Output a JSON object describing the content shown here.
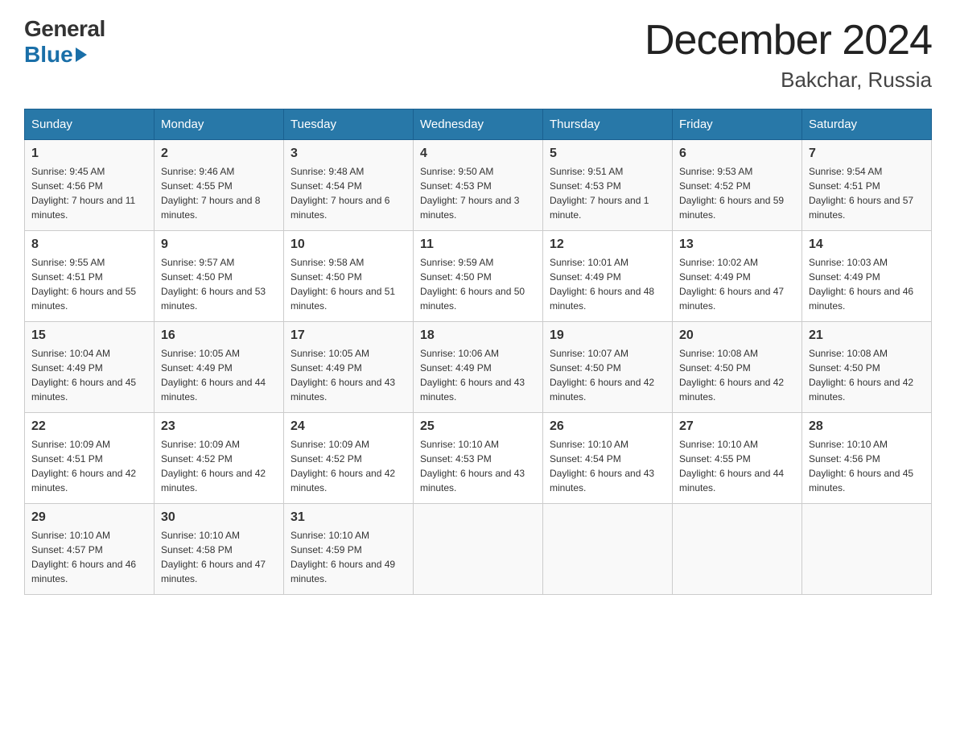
{
  "header": {
    "logo_general": "General",
    "logo_blue": "Blue",
    "month_title": "December 2024",
    "location": "Bakchar, Russia"
  },
  "days_of_week": [
    "Sunday",
    "Monday",
    "Tuesday",
    "Wednesday",
    "Thursday",
    "Friday",
    "Saturday"
  ],
  "weeks": [
    [
      {
        "day": "1",
        "sunrise": "9:45 AM",
        "sunset": "4:56 PM",
        "daylight": "7 hours and 11 minutes."
      },
      {
        "day": "2",
        "sunrise": "9:46 AM",
        "sunset": "4:55 PM",
        "daylight": "7 hours and 8 minutes."
      },
      {
        "day": "3",
        "sunrise": "9:48 AM",
        "sunset": "4:54 PM",
        "daylight": "7 hours and 6 minutes."
      },
      {
        "day": "4",
        "sunrise": "9:50 AM",
        "sunset": "4:53 PM",
        "daylight": "7 hours and 3 minutes."
      },
      {
        "day": "5",
        "sunrise": "9:51 AM",
        "sunset": "4:53 PM",
        "daylight": "7 hours and 1 minute."
      },
      {
        "day": "6",
        "sunrise": "9:53 AM",
        "sunset": "4:52 PM",
        "daylight": "6 hours and 59 minutes."
      },
      {
        "day": "7",
        "sunrise": "9:54 AM",
        "sunset": "4:51 PM",
        "daylight": "6 hours and 57 minutes."
      }
    ],
    [
      {
        "day": "8",
        "sunrise": "9:55 AM",
        "sunset": "4:51 PM",
        "daylight": "6 hours and 55 minutes."
      },
      {
        "day": "9",
        "sunrise": "9:57 AM",
        "sunset": "4:50 PM",
        "daylight": "6 hours and 53 minutes."
      },
      {
        "day": "10",
        "sunrise": "9:58 AM",
        "sunset": "4:50 PM",
        "daylight": "6 hours and 51 minutes."
      },
      {
        "day": "11",
        "sunrise": "9:59 AM",
        "sunset": "4:50 PM",
        "daylight": "6 hours and 50 minutes."
      },
      {
        "day": "12",
        "sunrise": "10:01 AM",
        "sunset": "4:49 PM",
        "daylight": "6 hours and 48 minutes."
      },
      {
        "day": "13",
        "sunrise": "10:02 AM",
        "sunset": "4:49 PM",
        "daylight": "6 hours and 47 minutes."
      },
      {
        "day": "14",
        "sunrise": "10:03 AM",
        "sunset": "4:49 PM",
        "daylight": "6 hours and 46 minutes."
      }
    ],
    [
      {
        "day": "15",
        "sunrise": "10:04 AM",
        "sunset": "4:49 PM",
        "daylight": "6 hours and 45 minutes."
      },
      {
        "day": "16",
        "sunrise": "10:05 AM",
        "sunset": "4:49 PM",
        "daylight": "6 hours and 44 minutes."
      },
      {
        "day": "17",
        "sunrise": "10:05 AM",
        "sunset": "4:49 PM",
        "daylight": "6 hours and 43 minutes."
      },
      {
        "day": "18",
        "sunrise": "10:06 AM",
        "sunset": "4:49 PM",
        "daylight": "6 hours and 43 minutes."
      },
      {
        "day": "19",
        "sunrise": "10:07 AM",
        "sunset": "4:50 PM",
        "daylight": "6 hours and 42 minutes."
      },
      {
        "day": "20",
        "sunrise": "10:08 AM",
        "sunset": "4:50 PM",
        "daylight": "6 hours and 42 minutes."
      },
      {
        "day": "21",
        "sunrise": "10:08 AM",
        "sunset": "4:50 PM",
        "daylight": "6 hours and 42 minutes."
      }
    ],
    [
      {
        "day": "22",
        "sunrise": "10:09 AM",
        "sunset": "4:51 PM",
        "daylight": "6 hours and 42 minutes."
      },
      {
        "day": "23",
        "sunrise": "10:09 AM",
        "sunset": "4:52 PM",
        "daylight": "6 hours and 42 minutes."
      },
      {
        "day": "24",
        "sunrise": "10:09 AM",
        "sunset": "4:52 PM",
        "daylight": "6 hours and 42 minutes."
      },
      {
        "day": "25",
        "sunrise": "10:10 AM",
        "sunset": "4:53 PM",
        "daylight": "6 hours and 43 minutes."
      },
      {
        "day": "26",
        "sunrise": "10:10 AM",
        "sunset": "4:54 PM",
        "daylight": "6 hours and 43 minutes."
      },
      {
        "day": "27",
        "sunrise": "10:10 AM",
        "sunset": "4:55 PM",
        "daylight": "6 hours and 44 minutes."
      },
      {
        "day": "28",
        "sunrise": "10:10 AM",
        "sunset": "4:56 PM",
        "daylight": "6 hours and 45 minutes."
      }
    ],
    [
      {
        "day": "29",
        "sunrise": "10:10 AM",
        "sunset": "4:57 PM",
        "daylight": "6 hours and 46 minutes."
      },
      {
        "day": "30",
        "sunrise": "10:10 AM",
        "sunset": "4:58 PM",
        "daylight": "6 hours and 47 minutes."
      },
      {
        "day": "31",
        "sunrise": "10:10 AM",
        "sunset": "4:59 PM",
        "daylight": "6 hours and 49 minutes."
      },
      null,
      null,
      null,
      null
    ]
  ],
  "labels": {
    "sunrise": "Sunrise:",
    "sunset": "Sunset:",
    "daylight": "Daylight:"
  }
}
